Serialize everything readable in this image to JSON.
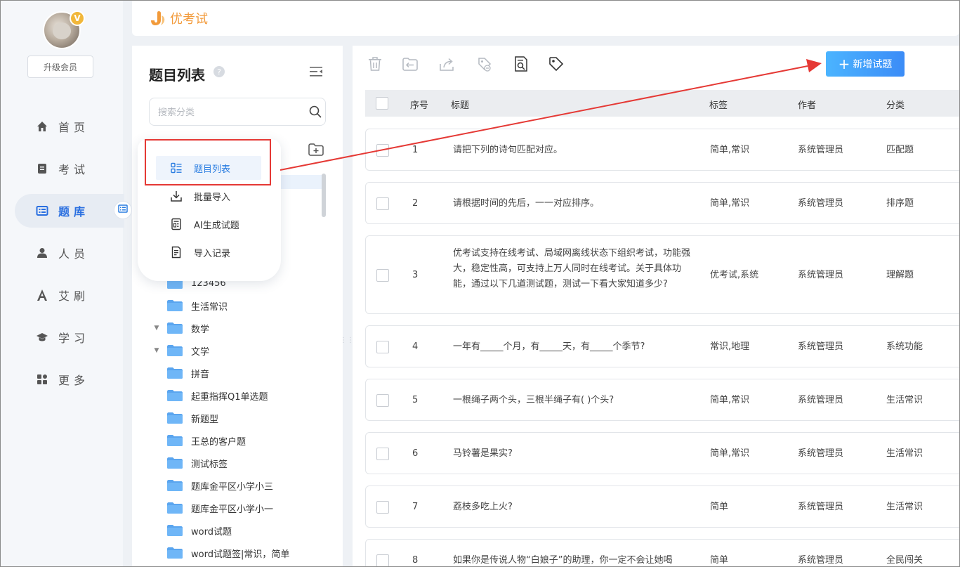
{
  "sidebar": {
    "vip_badge": "V",
    "upgrade_label": "升级会员",
    "items": [
      {
        "label": "首页",
        "icon": "home-icon"
      },
      {
        "label": "考试",
        "icon": "exam-icon"
      },
      {
        "label": "题库",
        "icon": "question-bank-icon"
      },
      {
        "label": "人员",
        "icon": "person-icon"
      },
      {
        "label": "艾刷",
        "icon": "ai-brush-icon"
      },
      {
        "label": "学习",
        "icon": "graduation-cap-icon"
      },
      {
        "label": "更多",
        "icon": "more-apps-icon"
      }
    ],
    "active_index": 2
  },
  "header": {
    "logo_text": "优考试",
    "brand_color": "#f29a3a"
  },
  "tree_panel": {
    "title": "题目列表",
    "help_glyph": "?",
    "search_placeholder": "搜索分类",
    "folders": [
      {
        "label": "123456"
      },
      {
        "label": "生活常识"
      },
      {
        "label": "数学",
        "expandable": true
      },
      {
        "label": "文学",
        "expandable": true
      },
      {
        "label": "拼音"
      },
      {
        "label": "起重指挥Q1单选题"
      },
      {
        "label": "新题型"
      },
      {
        "label": "王总的客户题"
      },
      {
        "label": "测试标签"
      },
      {
        "label": "题库金平区小学小三"
      },
      {
        "label": "题库金平区小学小一"
      },
      {
        "label": "word试题"
      },
      {
        "label": "word试题签|常识，简单"
      }
    ]
  },
  "popup_menu": {
    "items": [
      {
        "label": "题目列表",
        "icon": "list-icon",
        "active": true
      },
      {
        "label": "批量导入",
        "icon": "download-icon"
      },
      {
        "label": "AI生成试题",
        "icon": "ai-generate-icon"
      },
      {
        "label": "导入记录",
        "icon": "record-icon"
      }
    ]
  },
  "toolbar": {
    "icons": [
      "delete-icon",
      "move-icon",
      "share-icon",
      "tag-remove-icon",
      "preview-icon",
      "tag-icon"
    ],
    "add_button_label": "新增试题",
    "add_button_plus": "+",
    "accent_color": "#3b8cf7"
  },
  "table": {
    "columns": {
      "index": "序号",
      "title": "标题",
      "tags": "标签",
      "author": "作者",
      "category": "分类"
    },
    "rows": [
      {
        "index": "1",
        "title": "请把下列的诗句匹配对应。",
        "tags": "简单,常识",
        "author": "系统管理员",
        "category": "匹配题"
      },
      {
        "index": "2",
        "title": "请根据时间的先后，一一对应排序。",
        "tags": "简单,常识",
        "author": "系统管理员",
        "category": "排序题"
      },
      {
        "index": "3",
        "title": "优考试支持在线考试、局域网离线状态下组织考试，功能强大，稳定性高，可支持上万人同时在线考试。关于具体功能，通过以下几道测试题，测试一下看大家知道多少?",
        "tags": "优考试,系统",
        "author": "系统管理员",
        "category": "理解题"
      },
      {
        "index": "4",
        "title": "一年有_____个月，有_____天，有_____个季节?",
        "tags": "常识,地理",
        "author": "系统管理员",
        "category": "系统功能"
      },
      {
        "index": "5",
        "title": "一根绳子两个头，三根半绳子有(      )个头?",
        "tags": "简单,常识",
        "author": "系统管理员",
        "category": "生活常识"
      },
      {
        "index": "6",
        "title": "马铃薯是果实?",
        "tags": "简单,常识",
        "author": "系统管理员",
        "category": "生活常识"
      },
      {
        "index": "7",
        "title": "荔枝多吃上火?",
        "tags": "简单",
        "author": "系统管理员",
        "category": "生活常识"
      },
      {
        "index": "8",
        "title": "如果你是传说人物“白娘子”的助理，你一定不会让她喝",
        "tags": "简单",
        "author": "系统管理员",
        "category": "全民闯关"
      }
    ]
  },
  "annotation_color": "#e53935"
}
